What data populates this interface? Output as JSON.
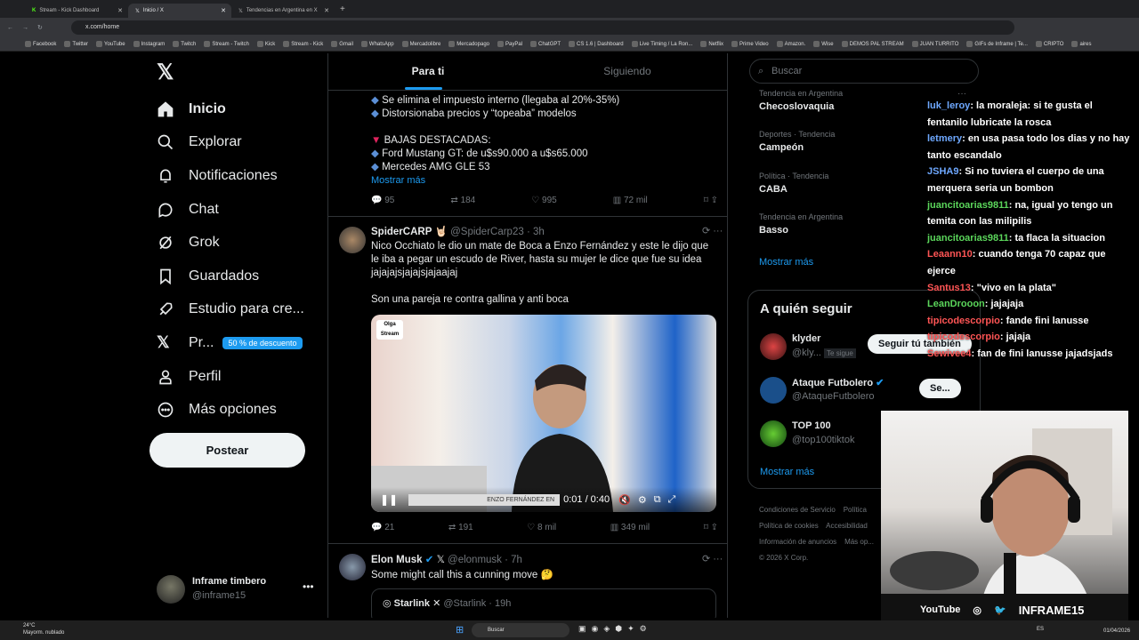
{
  "browser": {
    "tabs": [
      "Stream - Kick Dashboard",
      "Inicio / X",
      "Tendencias en Argentina en X"
    ],
    "url": "x.com/home",
    "bookmarks": [
      "Facebook",
      "Twitter",
      "YouTube",
      "Instagram",
      "Twitch",
      "Stream - Twitch",
      "Kick",
      "Stream - Kick",
      "Gmail",
      "WhatsApp",
      "Mercadolibre",
      "Mercadopago",
      "PayPal",
      "ChatGPT",
      "CS 1.6 | Dashboard",
      "Live Timing / La Ron...",
      "Netflix",
      "Prime Video",
      "Amazon.",
      "Wise",
      "DEMOS PAL STREAM",
      "JUAN TURRITO",
      "GIFs de Inframe | Te...",
      "CRIPTO",
      "aires"
    ]
  },
  "nav": {
    "items": [
      "Inicio",
      "Explorar",
      "Notificaciones",
      "Chat",
      "Grok",
      "Guardados",
      "Estudio para cre...",
      "Pr...",
      "Perfil",
      "Más opciones"
    ],
    "premium_badge": "50 % de descuento",
    "post": "Postear",
    "profile_name": "Inframe timbero",
    "profile_handle": "@inframe15"
  },
  "feed": {
    "tabs": [
      "Para ti",
      "Siguiendo"
    ],
    "post1": {
      "lines": [
        "Se elimina el impuesto interno (llegaba al 20%-35%)",
        "Distorsionaba precios y “topeaba” modelos",
        "BAJAS DESTACADAS:",
        "Ford Mustang GT: de u$s90.000 a u$s65.000",
        "Mercedes AMG GLE 53"
      ],
      "more": "Mostrar más",
      "stats": [
        "95",
        "184",
        "995",
        "72 mil"
      ]
    },
    "post2": {
      "name": "SpiderCARP",
      "handle": "@SpiderCarp23 · 3h",
      "text": "Nico Occhiato le dio un mate de Boca a Enzo Fernández y este le dijo que le iba a pegar un escudo de River, hasta su mujer le dice que fue su idea jajajajsjajajsjajaajaj",
      "text2": "Son una pareja re contra gallina y anti boca",
      "video_time": "0:01 / 0:40",
      "video_caption": "ENZO FERNÁNDEZ EN",
      "stats": [
        "21",
        "191",
        "8 mil",
        "349 mil"
      ]
    },
    "post3": {
      "name": "Elon Musk",
      "handle": "@elonmusk · 7h",
      "text": "Some might call this a cunning move 🤔",
      "quote_name": "Starlink",
      "quote_handle": "@Starlink · 19h"
    }
  },
  "sidebar": {
    "search_placeholder": "Buscar",
    "trends": [
      {
        "meta": "Tendencia en Argentina",
        "name": "Checoslovaquia"
      },
      {
        "meta": "Deportes · Tendencia",
        "name": "Campeón"
      },
      {
        "meta": "Política · Tendencia",
        "name": "CABA"
      },
      {
        "meta": "Tendencia en Argentina",
        "name": "Basso"
      }
    ],
    "show_more": "Mostrar más",
    "follow_title": "A quién seguir",
    "follow": [
      {
        "name": "klyder",
        "handle": "@kly...",
        "badge": "Te sigue"
      },
      {
        "name": "Ataque Futbolero",
        "handle": "@AtaqueFutbolero"
      },
      {
        "name": "TOP 100",
        "handle": "@top100tiktok"
      }
    ],
    "follow_back": "Seguir tú también",
    "follow_btn": "Se...",
    "footer": [
      "Condiciones de Servicio",
      "Política",
      "Política de cookies",
      "Accesibilidad",
      "Información de anuncios",
      "Más op...",
      "© 2026 X Corp."
    ]
  },
  "chat": [
    {
      "user": "luk_leroy",
      "color": "#6ea8ff",
      "msg": ": la moraleja: si te gusta el fentanilo lubricate la rosca"
    },
    {
      "user": "letmery",
      "color": "#6ea8ff",
      "msg": ": en usa pasa todo los dias y no hay tanto escandalo"
    },
    {
      "user": "JSHA9",
      "color": "#6ea8ff",
      "msg": ": Si no tuviera el cuerpo de una merquera seria un bombon"
    },
    {
      "user": "juancitoarias9811",
      "color": "#5bd65b",
      "msg": ": na, igual yo tengo un temita con las milipilis"
    },
    {
      "user": "juancitoarias9811",
      "color": "#5bd65b",
      "msg": ": ta flaca la situacion"
    },
    {
      "user": "Leaann10",
      "color": "#ff5555",
      "msg": ": cuando tenga 70 capaz que ejerce"
    },
    {
      "user": "Santus13",
      "color": "#ff5555",
      "msg": ": \"vivo en la plata\""
    },
    {
      "user": "LeanDrooon",
      "color": "#5bd65b",
      "msg": ": jajajaja"
    },
    {
      "user": "tipicodescorpio",
      "color": "#ff5555",
      "msg": ": fande fini lanusse"
    },
    {
      "user": "tipicodescorpio",
      "color": "#ff5555",
      "msg": ": jajaja"
    },
    {
      "user": "Sewivee4",
      "color": "#ff5555",
      "msg": ": fan de fini lanusse jajadsjads"
    }
  ],
  "stream": {
    "overlay": "INFRAME15",
    "youtube": "YouTube"
  },
  "taskbar": {
    "weather": "24°C",
    "weather_desc": "Mayorm. nublado",
    "search": "Buscar",
    "lang": "ES",
    "date": "01/04/2026"
  }
}
